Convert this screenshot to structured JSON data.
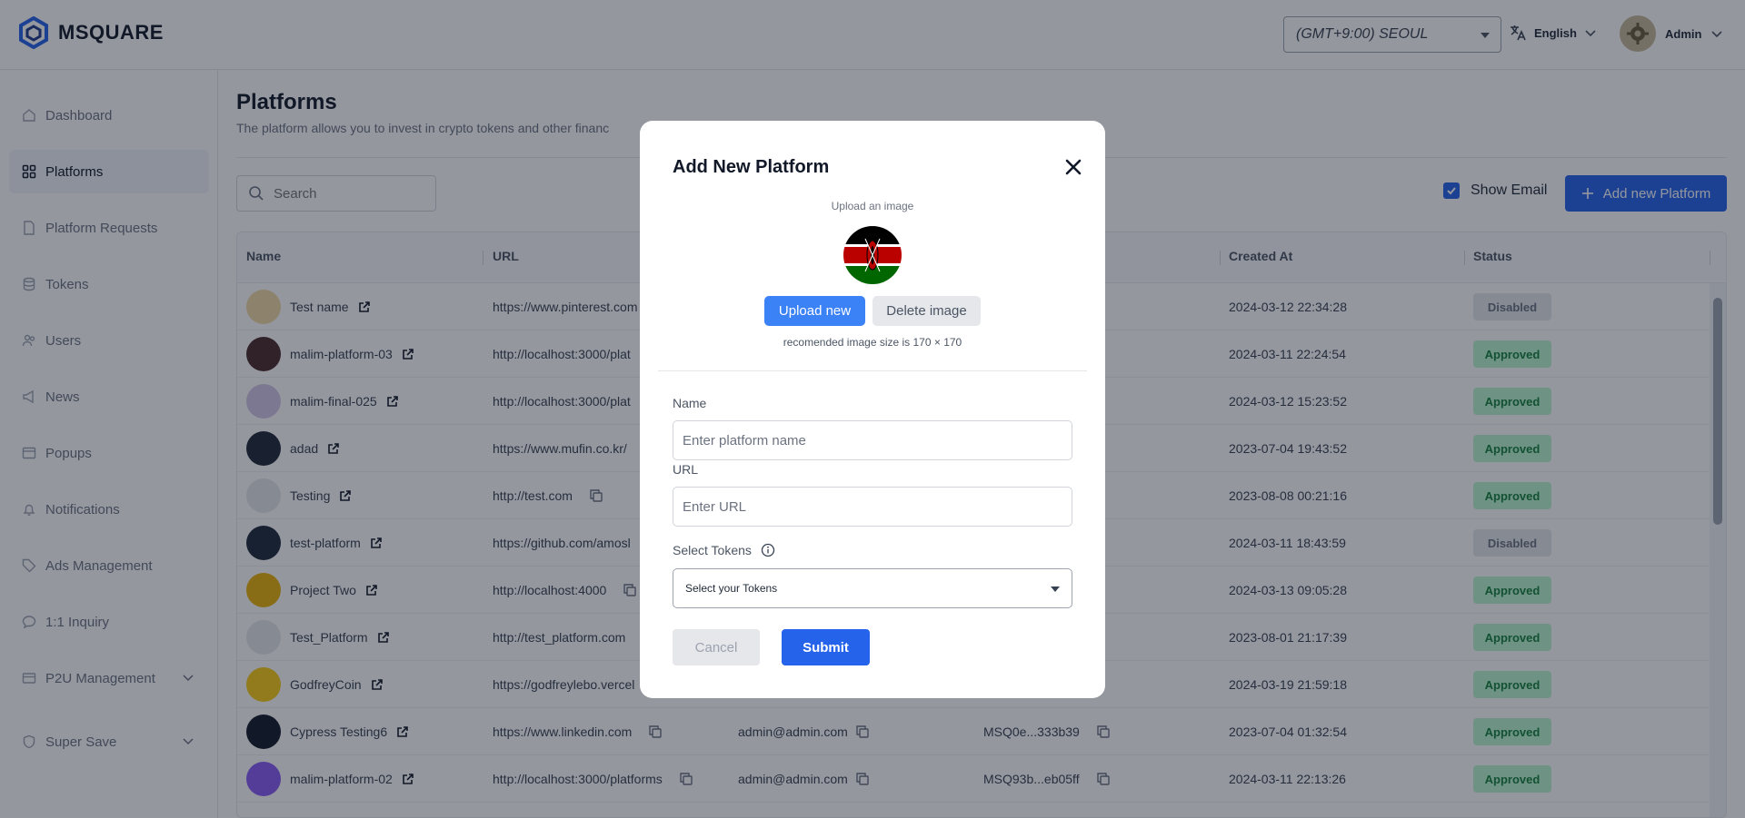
{
  "header": {
    "brand": "MSQUARE",
    "timezone": "(GMT+9:00) SEOUL",
    "language": "English",
    "user": "Admin"
  },
  "sidebar": {
    "items": [
      {
        "label": "Dashboard",
        "icon": "home-icon"
      },
      {
        "label": "Platforms",
        "icon": "grid-icon",
        "active": true
      },
      {
        "label": "Platform Requests",
        "icon": "document-icon"
      },
      {
        "label": "Tokens",
        "icon": "database-icon"
      },
      {
        "label": "Users",
        "icon": "users-icon"
      },
      {
        "label": "News",
        "icon": "megaphone-icon"
      },
      {
        "label": "Popups",
        "icon": "window-icon"
      },
      {
        "label": "Notifications",
        "icon": "bell-icon"
      },
      {
        "label": "Ads Management",
        "icon": "tag-icon"
      },
      {
        "label": "1:1 Inquiry",
        "icon": "chat-icon"
      },
      {
        "label": "P2U Management",
        "icon": "card-icon",
        "expandable": true
      },
      {
        "label": "Super Save",
        "icon": "shield-icon",
        "expandable": true
      }
    ]
  },
  "page": {
    "title": "Platforms",
    "description": "The platform allows you to invest in crypto tokens and other financ",
    "search_placeholder": "Search",
    "show_email_label": "Show Email",
    "add_button": "Add new Platform"
  },
  "table": {
    "columns": [
      "Name",
      "URL",
      "Created At",
      "Status"
    ],
    "rows": [
      {
        "name": "Test name",
        "url": "https://www.pinterest.com",
        "email": "",
        "token": "",
        "created": "2024-03-12 22:34:28",
        "status": "Disabled"
      },
      {
        "name": "malim-platform-03",
        "url": "http://localhost:3000/plat",
        "email": "",
        "token": "",
        "created": "2024-03-11 22:24:54",
        "status": "Approved"
      },
      {
        "name": "malim-final-025",
        "url": "http://localhost:3000/plat",
        "email": "",
        "token": "",
        "created": "2024-03-12 15:23:52",
        "status": "Approved"
      },
      {
        "name": "adad",
        "url": "https://www.mufin.co.kr/",
        "email": "",
        "token": "",
        "created": "2023-07-04 19:43:52",
        "status": "Approved"
      },
      {
        "name": "Testing",
        "url": "http://test.com",
        "email": "",
        "token": "",
        "created": "2023-08-08 00:21:16",
        "status": "Approved"
      },
      {
        "name": "test-platform",
        "url": "https://github.com/amosl",
        "email": "",
        "token": "",
        "created": "2024-03-11 18:43:59",
        "status": "Disabled"
      },
      {
        "name": "Project Two",
        "url": "http://localhost:4000",
        "email": "",
        "token": "",
        "created": "2024-03-13 09:05:28",
        "status": "Approved"
      },
      {
        "name": "Test_Platform",
        "url": "http://test_platform.com",
        "email": "",
        "token": "",
        "created": "2023-08-01 21:17:39",
        "status": "Approved"
      },
      {
        "name": "GodfreyCoin",
        "url": "https://godfreylebo.vercel",
        "email": "",
        "token": "",
        "created": "2024-03-19 21:59:18",
        "status": "Approved"
      },
      {
        "name": "Cypress Testing6",
        "url": "https://www.linkedin.com",
        "email": "admin@admin.com",
        "token": "MSQ0e...333b39",
        "created": "2023-07-04 01:32:54",
        "status": "Approved"
      },
      {
        "name": "malim-platform-02",
        "url": "http://localhost:3000/platforms",
        "email": "admin@admin.com",
        "token": "MSQ93b...eb05ff",
        "created": "2024-03-11 22:13:26",
        "status": "Approved"
      }
    ],
    "avatar_colors": [
      "#f3d9a5",
      "#4b2a2a",
      "#d6c7e8",
      "#1f2937",
      "#e5e7eb",
      "#1e293b",
      "#eab308",
      "#e5e7eb",
      "#facc15",
      "#111827",
      "#8b5cf6"
    ]
  },
  "modal": {
    "title": "Add New Platform",
    "upload_label": "Upload an image",
    "upload_button": "Upload new",
    "delete_button": "Delete image",
    "recommended": "recomended image size is 170 × 170",
    "name_label": "Name",
    "name_placeholder": "Enter platform name",
    "url_label": "URL",
    "url_placeholder": "Enter URL",
    "tokens_label": "Select Tokens",
    "tokens_placeholder": "Select your Tokens",
    "cancel": "Cancel",
    "submit": "Submit"
  },
  "colors": {
    "primary": "#2563eb",
    "approved_bg": "#bbf7d0",
    "approved_text": "#15803d",
    "disabled_bg": "#e5e7eb"
  }
}
